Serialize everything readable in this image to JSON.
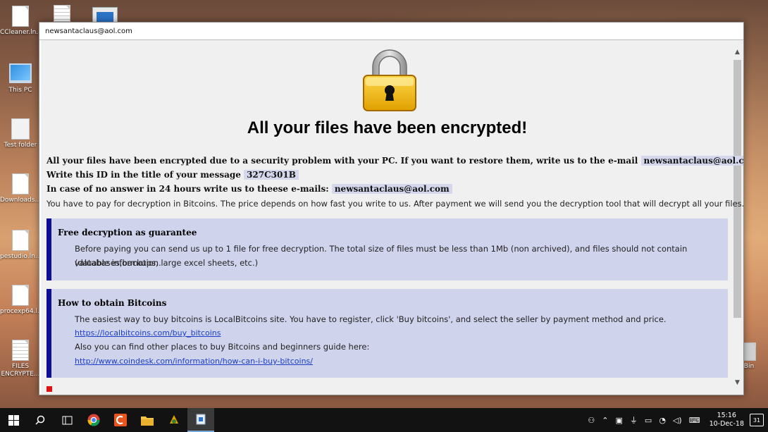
{
  "desktop": {
    "icons": [
      {
        "label": "CCleaner.ln...",
        "icon": "file-icon"
      },
      {
        "label": "This PC",
        "icon": "computer-icon"
      },
      {
        "label": "Test folder",
        "icon": "folder-icon"
      },
      {
        "label": "Downloads...",
        "icon": "file-icon"
      },
      {
        "label": "pestudio.ln...",
        "icon": "file-icon"
      },
      {
        "label": "procexp64.l...",
        "icon": "file-icon"
      },
      {
        "label": "FILES ENCRYPTE...",
        "icon": "document-icon"
      },
      {
        "label": "Bin",
        "icon": "recycle-bin-icon"
      }
    ]
  },
  "window": {
    "title": "newsantaclaus@aol.com",
    "headline": "All your files have been encrypted!",
    "line1_text": "All your files have been encrypted due to a security problem with your PC. If you want to restore them, write us to the e-mail",
    "line1_email": "newsantaclaus@aol.com",
    "line2_text": "Write this ID in the title of your message",
    "line2_id": "327C301B",
    "line3_text": "In case of no answer in 24 hours write us to theese e-mails:",
    "line3_email": "newsantaclaus@aol.com",
    "line4_text": "You have to pay for decryption in Bitcoins. The price depends on how fast you write to us. After payment we will send you the decryption tool that will decrypt all your files.",
    "panel1": {
      "heading": "Free decryption as guarantee",
      "text1": "Before paying you can send us up to 1 file for free decryption. The total size of files must be less than 1Mb (non archived), and files should not contain valuable information.",
      "text2": "(databases,backups, large excel sheets, etc.)"
    },
    "panel2": {
      "heading": "How to obtain Bitcoins",
      "text1": "The easiest way to buy bitcoins is LocalBitcoins site. You have to register, click 'Buy bitcoins', and select the seller by payment method and price.",
      "link1": "https://localbitcoins.com/buy_bitcoins",
      "text2": "Also you can find other places to buy Bitcoins and beginners guide here:",
      "link2": "http://www.coindesk.com/information/how-can-i-buy-bitcoins/"
    }
  },
  "taskbar": {
    "time": "15:16",
    "date": "10-Dec-18",
    "notifications": "31",
    "accent": "#7aa9d9"
  }
}
